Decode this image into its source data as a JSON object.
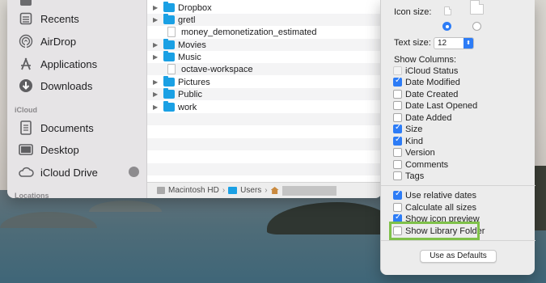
{
  "sidebar": {
    "items": [
      {
        "label": "Recents",
        "icon": "recents-icon"
      },
      {
        "label": "AirDrop",
        "icon": "airdrop-icon"
      },
      {
        "label": "Applications",
        "icon": "applications-icon"
      },
      {
        "label": "Downloads",
        "icon": "downloads-icon"
      }
    ],
    "icloud_header": "iCloud",
    "icloud_items": [
      {
        "label": "Documents",
        "icon": "documents-icon"
      },
      {
        "label": "Desktop",
        "icon": "desktop-icon"
      },
      {
        "label": "iCloud Drive",
        "icon": "cloud-icon"
      }
    ],
    "locations_header": "Locations"
  },
  "files": [
    {
      "name": "Dropbox",
      "type": "folder"
    },
    {
      "name": "gretl",
      "type": "folder"
    },
    {
      "name": "money_demonetization_estimated",
      "type": "file"
    },
    {
      "name": "Movies",
      "type": "folder"
    },
    {
      "name": "Music",
      "type": "folder"
    },
    {
      "name": "octave-workspace",
      "type": "file"
    },
    {
      "name": "Pictures",
      "type": "folder"
    },
    {
      "name": "Public",
      "type": "folder"
    },
    {
      "name": "work",
      "type": "folder"
    }
  ],
  "pathbar": {
    "items": [
      "Macintosh HD",
      "Users"
    ],
    "separator": "›"
  },
  "view_options": {
    "icon_size_label": "Icon size:",
    "text_size_label": "Text size:",
    "text_size_value": "12",
    "show_columns_label": "Show Columns:",
    "columns": [
      {
        "label": "iCloud Status",
        "checked": false,
        "disabled": true
      },
      {
        "label": "Date Modified",
        "checked": true
      },
      {
        "label": "Date Created",
        "checked": false
      },
      {
        "label": "Date Last Opened",
        "checked": false
      },
      {
        "label": "Date Added",
        "checked": false
      },
      {
        "label": "Size",
        "checked": true
      },
      {
        "label": "Kind",
        "checked": true
      },
      {
        "label": "Version",
        "checked": false
      },
      {
        "label": "Comments",
        "checked": false
      },
      {
        "label": "Tags",
        "checked": false
      }
    ],
    "options": [
      {
        "label": "Use relative dates",
        "checked": true
      },
      {
        "label": "Calculate all sizes",
        "checked": false
      },
      {
        "label": "Show icon preview",
        "checked": true
      },
      {
        "label": "Show Library Folder",
        "checked": false
      }
    ],
    "defaults_button": "Use as Defaults"
  },
  "colors": {
    "accent": "#2d7cf6",
    "folder": "#1aa0e4",
    "highlight": "#7fc14a"
  }
}
